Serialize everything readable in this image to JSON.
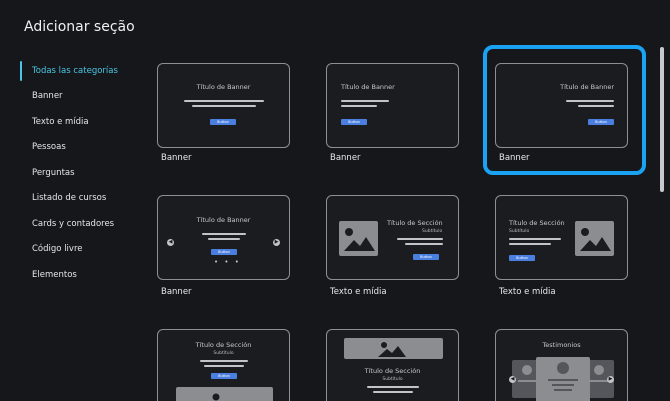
{
  "dialog": {
    "title": "Adicionar seção"
  },
  "sidebar": {
    "items": [
      {
        "label": "Todas las categorías",
        "active": true
      },
      {
        "label": "Banner"
      },
      {
        "label": "Texto e mídia"
      },
      {
        "label": "Pessoas"
      },
      {
        "label": "Perguntas"
      },
      {
        "label": "Listado de cursos"
      },
      {
        "label": "Cards y contadores"
      },
      {
        "label": "Código livre"
      },
      {
        "label": "Elementos"
      }
    ]
  },
  "templates": {
    "card1": {
      "label": "Banner",
      "heading": "Título de Banner",
      "button": "Button"
    },
    "card2": {
      "label": "Banner",
      "heading": "Título de Banner",
      "button": "Button"
    },
    "card3": {
      "label": "Banner",
      "heading": "Título de Banner",
      "button": "Button",
      "selected": true
    },
    "card4": {
      "label": "Banner",
      "heading": "Título de Banner",
      "button": "Button",
      "dots": "• • •"
    },
    "card5": {
      "label": "Texto e mídia",
      "heading": "Título de Sección",
      "subtitle": "Subtítulo",
      "button": "Button"
    },
    "card6": {
      "label": "Texto e mídia",
      "heading": "Título de Sección",
      "subtitle": "Subtítulo",
      "button": "Button"
    },
    "card7": {
      "heading": "Título de Sección",
      "subtitle": "Subtítulo",
      "button": "Button"
    },
    "card8": {
      "heading": "Título de Sección",
      "subtitle": "Subtítulo"
    },
    "card9": {
      "heading": "Testimonios"
    }
  },
  "colors": {
    "accent": "#49c6e5",
    "selection": "#1aa3f2",
    "button": "#4a7fe0",
    "background": "#16171b"
  },
  "icons": {
    "carousel_prev": "chevron-left-icon",
    "carousel_next": "chevron-right-icon",
    "image_placeholder": "image-icon",
    "avatar": "avatar-icon"
  }
}
